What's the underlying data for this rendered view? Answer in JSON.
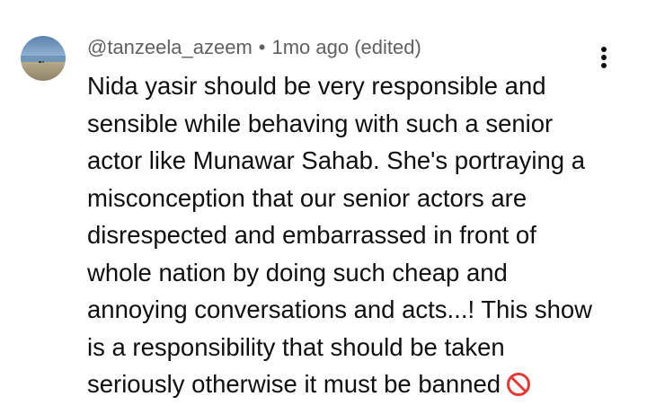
{
  "comment": {
    "author": "@tanzeela_azeem",
    "separator": "•",
    "time": "1mo ago",
    "edited": "(edited)",
    "text_lines": [
      "Nida yasir should be very responsible and",
      "sensible while behaving with such a senior",
      "actor like Munawar Sahab. She's portraying a",
      "misconception that our senior actors are",
      "disrespected and embarrassed in front of",
      "whole nation by doing such cheap and",
      "annoying conversations and acts...! This show",
      "is a responsibility that should be taken",
      "seriously otherwise it must be banned"
    ],
    "trailing_emoji": "no-entry-sign",
    "menu_icon": "more-vertical-icon",
    "avatar_icon": "beach-photo-avatar"
  },
  "colors": {
    "text_primary": "#0f0f0f",
    "text_secondary": "#606060",
    "emoji_red": "#e53935"
  }
}
